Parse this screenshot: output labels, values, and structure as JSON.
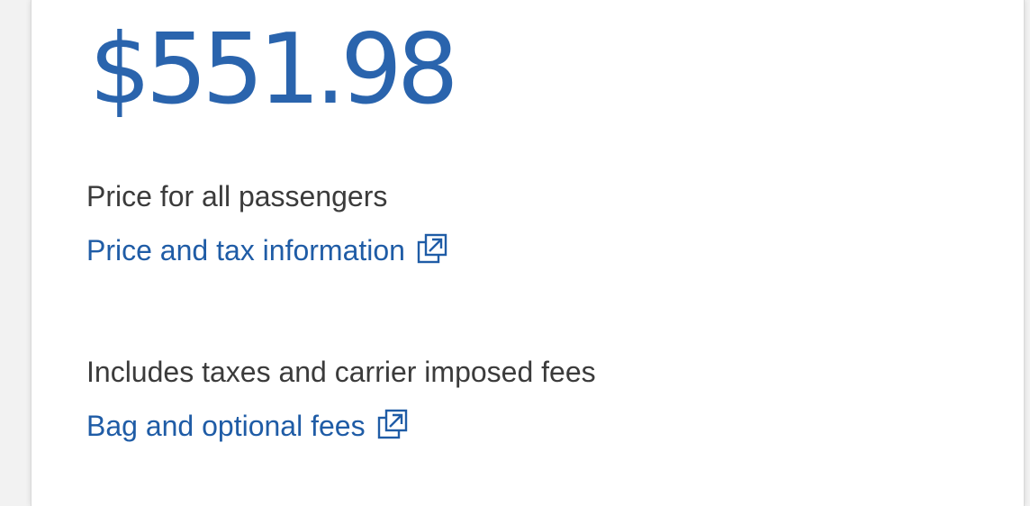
{
  "fare": {
    "price": "$551.98",
    "price_note": "Price for all passengers",
    "price_tax_link": "Price and tax information",
    "fees_note": "Includes taxes and carrier imposed fees",
    "bag_fees_link": "Bag and optional fees"
  },
  "icons": {
    "external_link": "external-link-icon"
  },
  "colors": {
    "price": "#2a64ad",
    "link": "#1f5ca6",
    "text": "#3b3b3b"
  }
}
